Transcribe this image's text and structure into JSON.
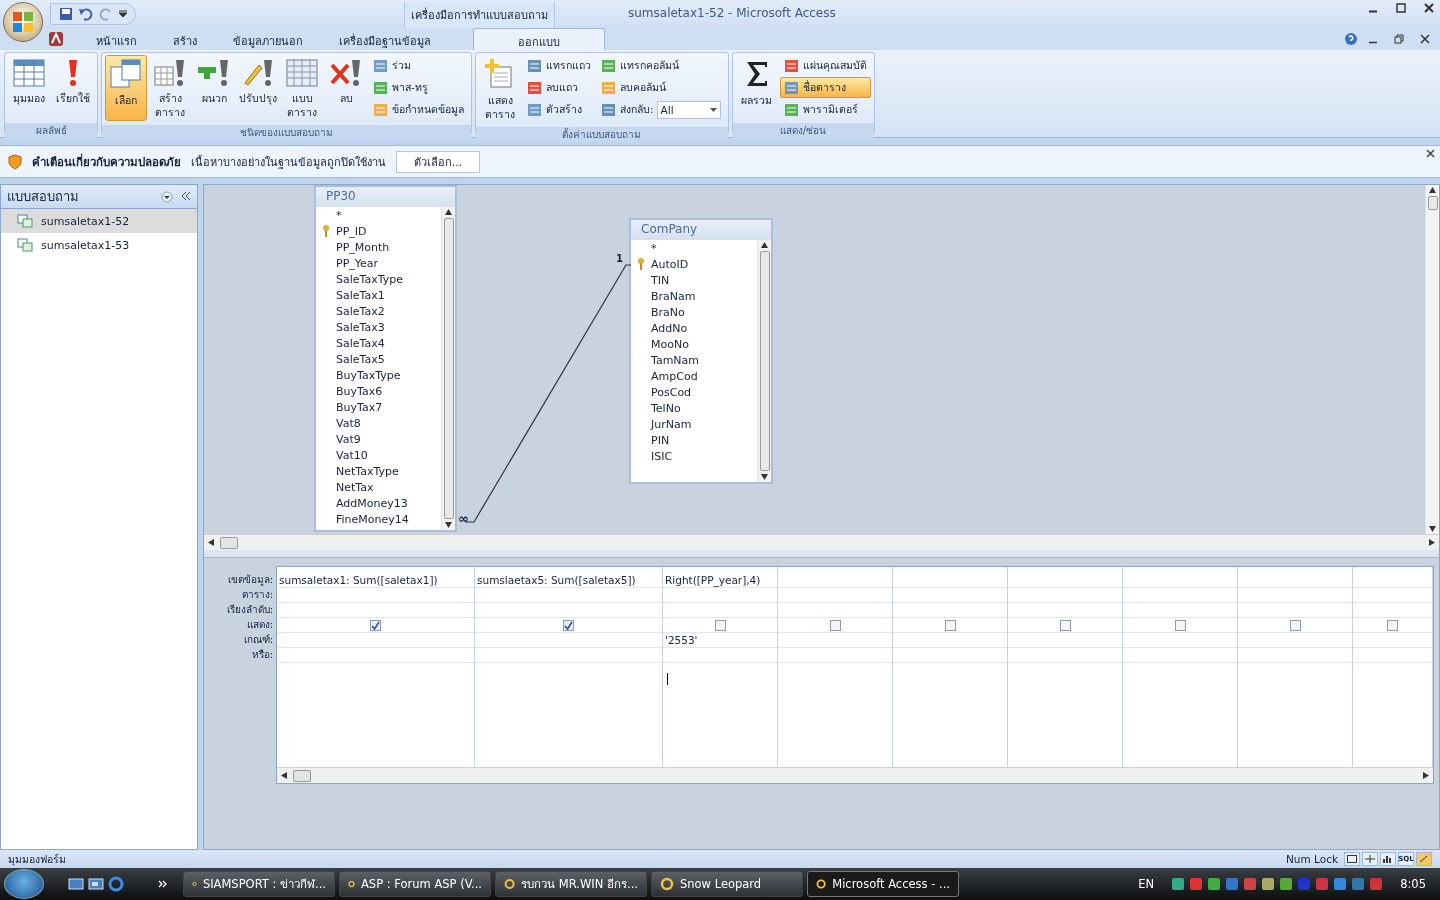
{
  "title_bar": {
    "context_label": "เครื่องมือการทำแบบสอบถาม",
    "title": "sumsaletax1-52 - Microsoft Access"
  },
  "tabs": [
    {
      "label": "หน้าแรก",
      "selected": false
    },
    {
      "label": "สร้าง",
      "selected": false
    },
    {
      "label": "ข้อมูลภายนอก",
      "selected": false
    },
    {
      "label": "เครื่องมือฐานข้อมูล",
      "selected": false
    },
    {
      "label": "ออกแบบ",
      "selected": true
    }
  ],
  "ribbon_groups": [
    {
      "label": "ผลลัพธ์",
      "buttons": [
        {
          "kind": "large",
          "label": "มุมมอง",
          "selected": false
        },
        {
          "kind": "large",
          "label": "เรียกใช้",
          "selected": false
        }
      ]
    },
    {
      "label": "ชนิดของแบบสอบถาม",
      "buttons": [
        {
          "kind": "large",
          "label": "เลือก",
          "selected": true
        },
        {
          "kind": "large",
          "label": "สร้าง\nตาราง",
          "selected": false
        },
        {
          "kind": "large",
          "label": "ผนวก",
          "selected": false
        },
        {
          "kind": "large",
          "label": "ปรับปรุง",
          "selected": false
        },
        {
          "kind": "large",
          "label": "แบบ\nตาราง",
          "selected": false
        },
        {
          "kind": "large",
          "label": "ลบ",
          "selected": false
        },
        {
          "kind": "small",
          "label": "ร่วม",
          "selected": false
        },
        {
          "kind": "small",
          "label": "พาส-ทรู",
          "selected": false
        },
        {
          "kind": "small",
          "label": "ข้อกำหนดข้อมูล",
          "selected": false
        }
      ]
    },
    {
      "label": "ตั้งค่าแบบสอบถาม",
      "buttons": [
        {
          "kind": "large",
          "label": "แสดง\nตาราง",
          "selected": false
        },
        {
          "kind": "small",
          "label": "แทรกแถว",
          "selected": false
        },
        {
          "kind": "small",
          "label": "ลบแถว",
          "selected": false
        },
        {
          "kind": "small",
          "label": "ตัวสร้าง",
          "selected": false
        },
        {
          "kind": "small",
          "label": "แทรกคอลัมน์",
          "selected": false
        },
        {
          "kind": "small",
          "label": "ลบคอลัมน์",
          "selected": false
        },
        {
          "kind": "combo",
          "label": "ส่งกลับ:",
          "value": "All"
        }
      ]
    },
    {
      "label": "แสดง/ซ่อน",
      "buttons": [
        {
          "kind": "large",
          "label": "ผลรวม",
          "selected": false
        },
        {
          "kind": "small",
          "label": "แผ่นคุณสมบัติ",
          "selected": false
        },
        {
          "kind": "small",
          "label": "ชื่อตาราง",
          "selected": true
        },
        {
          "kind": "small",
          "label": "พารามิเตอร์",
          "selected": false
        }
      ]
    }
  ],
  "security_bar": {
    "title": "คำเตือนเกี่ยวกับความปลอดภัย",
    "message": "เนื้อหาบางอย่างในฐานข้อมูลถูกปิดใช้งาน",
    "button": "ตัวเลือก..."
  },
  "nav_pane": {
    "header": "แบบสอบถาม",
    "items": [
      {
        "label": "sumsaletax1-52",
        "selected": true
      },
      {
        "label": "sumsaletax1-53",
        "selected": false
      }
    ]
  },
  "tables": [
    {
      "name": "PP30",
      "fields": [
        {
          "name": "*",
          "key": false
        },
        {
          "name": "PP_ID",
          "key": true
        },
        {
          "name": "PP_Month",
          "key": false
        },
        {
          "name": "PP_Year",
          "key": false
        },
        {
          "name": "SaleTaxType",
          "key": false
        },
        {
          "name": "SaleTax1",
          "key": false
        },
        {
          "name": "SaleTax2",
          "key": false
        },
        {
          "name": "SaleTax3",
          "key": false
        },
        {
          "name": "SaleTax4",
          "key": false
        },
        {
          "name": "SaleTax5",
          "key": false
        },
        {
          "name": "BuyTaxType",
          "key": false
        },
        {
          "name": "BuyTax6",
          "key": false
        },
        {
          "name": "BuyTax7",
          "key": false
        },
        {
          "name": "Vat8",
          "key": false
        },
        {
          "name": "Vat9",
          "key": false
        },
        {
          "name": "Vat10",
          "key": false
        },
        {
          "name": "NetTaxType",
          "key": false
        },
        {
          "name": "NetTax",
          "key": false
        },
        {
          "name": "AddMoney13",
          "key": false
        },
        {
          "name": "FineMoney14",
          "key": false
        }
      ]
    },
    {
      "name": "ComPany",
      "fields": [
        {
          "name": "*",
          "key": false
        },
        {
          "name": "AutoID",
          "key": true
        },
        {
          "name": "TIN",
          "key": false
        },
        {
          "name": "BraNam",
          "key": false
        },
        {
          "name": "BraNo",
          "key": false
        },
        {
          "name": "AddNo",
          "key": false
        },
        {
          "name": "MooNo",
          "key": false
        },
        {
          "name": "TamNam",
          "key": false
        },
        {
          "name": "AmpCod",
          "key": false
        },
        {
          "name": "PosCod",
          "key": false
        },
        {
          "name": "TelNo",
          "key": false
        },
        {
          "name": "JurNam",
          "key": false
        },
        {
          "name": "PIN",
          "key": false
        },
        {
          "name": "ISIC",
          "key": false
        }
      ]
    }
  ],
  "relationship": {
    "one_label": "1",
    "many_label": "∞"
  },
  "grid": {
    "row_labels": [
      "เขตข้อมูล:",
      "ตาราง:",
      "เรียงลำดับ:",
      "แสดง:",
      "เกณฑ์:",
      "หรือ:"
    ],
    "columns": [
      {
        "field": "sumsaletax1: Sum([saletax1])",
        "show": true
      },
      {
        "field": "sumslaetax5: Sum([saletax5])",
        "show": true
      },
      {
        "field": "Right([PP_year],4)",
        "show": false,
        "criteria": "'2553'"
      },
      {
        "show": false
      },
      {
        "show": false
      },
      {
        "show": false
      },
      {
        "show": false
      },
      {
        "show": false
      },
      {
        "show": false
      }
    ]
  },
  "status_bar": {
    "text": "มุมมองฟอร์ม",
    "num_lock": "Num Lock",
    "sql": "SQL"
  },
  "taskbar": {
    "items": [
      {
        "label": "SIAMSPORT : ข่าวกีฬ...",
        "selected": false
      },
      {
        "label": "ASP : Forum ASP (V...",
        "selected": false
      },
      {
        "label": "รบกวน MR.WIN อีกร...",
        "selected": false
      },
      {
        "label": "Snow Leopard",
        "selected": false
      },
      {
        "label": "Microsoft Access - ...",
        "selected": true
      }
    ],
    "language": "EN",
    "time": "8:05"
  }
}
